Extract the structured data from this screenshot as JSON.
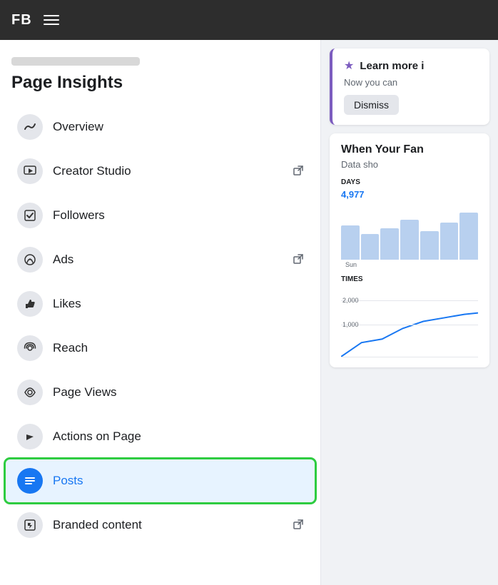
{
  "topnav": {
    "logo": "FB",
    "menu_label": "Menu"
  },
  "sidebar": {
    "title_bar": "",
    "title": "Page Insights",
    "items": [
      {
        "id": "overview",
        "label": "Overview",
        "icon": "〜",
        "external": false,
        "active": false
      },
      {
        "id": "creator-studio",
        "label": "Creator Studio",
        "icon": "▶",
        "external": true,
        "active": false
      },
      {
        "id": "followers",
        "label": "Followers",
        "icon": "✓",
        "external": false,
        "active": false
      },
      {
        "id": "ads",
        "label": "Ads",
        "icon": "📣",
        "external": true,
        "active": false
      },
      {
        "id": "likes",
        "label": "Likes",
        "icon": "👍",
        "external": false,
        "active": false
      },
      {
        "id": "reach",
        "label": "Reach",
        "icon": "📡",
        "external": false,
        "active": false
      },
      {
        "id": "page-views",
        "label": "Page Views",
        "icon": "👁",
        "external": false,
        "active": false
      },
      {
        "id": "actions-on-page",
        "label": "Actions on Page",
        "icon": "▲",
        "external": false,
        "active": false
      },
      {
        "id": "posts",
        "label": "Posts",
        "icon": "≡",
        "external": false,
        "active": true
      },
      {
        "id": "branded-content",
        "label": "Branded content",
        "icon": "🔖",
        "external": true,
        "active": false
      }
    ]
  },
  "right_panel": {
    "learn_card": {
      "icon": "★",
      "title": "Learn more i",
      "subtitle": "Now you can",
      "dismiss_label": "Dismiss"
    },
    "fan_card": {
      "title": "When Your Fan",
      "data_show_label": "Data sho",
      "days_label": "DAYS",
      "chart_value": "4,977",
      "days": [
        "Sun"
      ],
      "bars": [
        60,
        45,
        55,
        70,
        50,
        65,
        80
      ],
      "times_label": "TIMES",
      "gridlines": [
        {
          "value": "2,000",
          "top_pct": 20
        },
        {
          "value": "1,000",
          "top_pct": 55
        }
      ]
    }
  }
}
